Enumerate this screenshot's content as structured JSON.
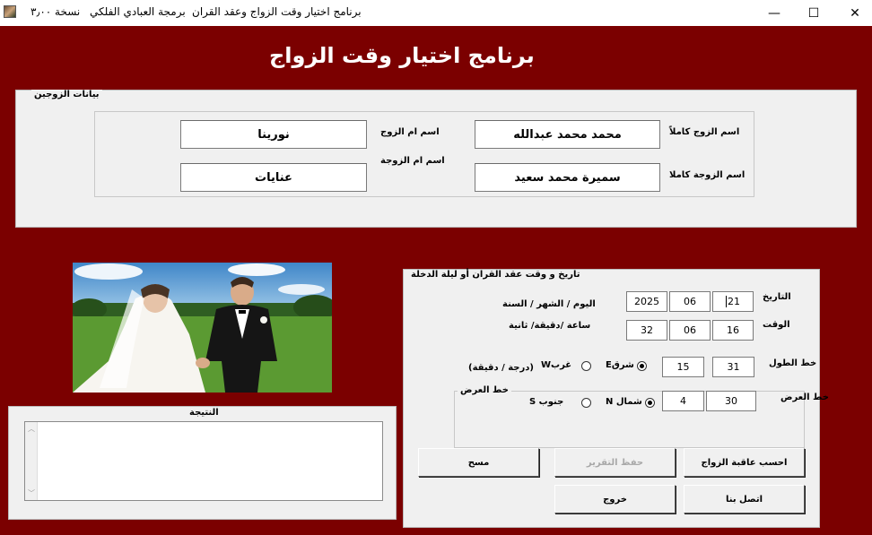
{
  "window": {
    "title": "برنامج  اختيار وقت الزواج وعقد القران   برمجة العبادي الفلكي   نسخة ٣٫٠٠",
    "title_app": "برنامج  اختيار وقت الزواج وعقد القران",
    "title_author": "برمجة العبادي الفلكي",
    "title_version": "نسخة ٣٫٠٠",
    "minimize_glyph": "—",
    "maximize_glyph": "☐",
    "close_glyph": "✕"
  },
  "header": {
    "title": "برنامج اختيار وقت الزواج"
  },
  "couple": {
    "legend": "بيانات الزوجين",
    "groom_label": "اسم الزوج كاملاً",
    "groom_value": "محمد محمد عبدالله",
    "bride_label": "اسم الزوجة كاملا",
    "bride_value": "سميرة محمد سعيد",
    "groom_mother_label": "اسم ام الزوج",
    "groom_mother_value": "نورينا",
    "bride_mother_label": "اسم ام الزوجة",
    "bride_mother_value": "عنايات"
  },
  "datetime": {
    "legend": "تاريخ و وقت عقد القران أو ليلة الدخلة",
    "date_label": "التاريخ",
    "date_hint": "اليوم / الشهر / السنة",
    "year": "2025",
    "month": "06",
    "day": "21",
    "time_label": "الوقت",
    "time_hint": "ساعة /دقيقة/ ثانية",
    "second": "32",
    "minute": "06",
    "hour": "16",
    "longitude_label": "خط الطول",
    "longitude_min": "15",
    "longitude_deg": "31",
    "east_label": "شرقE",
    "west_label": "غربW",
    "units_hint": "(درجة / دقيقة)",
    "latitude_group": "خط العرض",
    "latitude_label": "خط العرض",
    "latitude_min": "4",
    "latitude_deg": "30",
    "north_label": "شمال N",
    "south_label": "جنوب S"
  },
  "result": {
    "label": "النتيجة",
    "text": ""
  },
  "buttons": {
    "calculate": "احسب عاقبة الزواج",
    "save_report": "حفظ التقرير",
    "clear": "مسح",
    "contact": "اتصل بنا",
    "exit": "خروج"
  },
  "photo": {
    "alt": "bride-and-groom-photo"
  }
}
